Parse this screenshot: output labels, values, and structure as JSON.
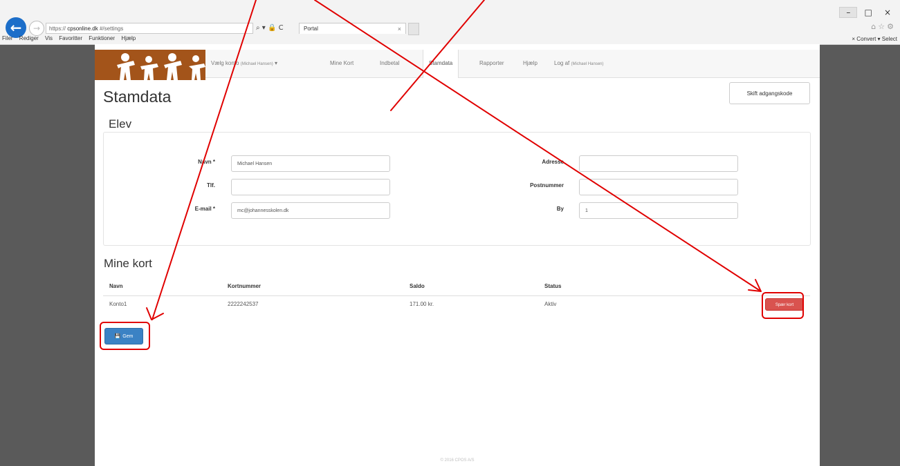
{
  "browser": {
    "address": "https://",
    "address_domain": "cpsonline.dk",
    "address_path": "#/settings",
    "search_hint": "⌕ ▾ 🔒 C",
    "tab_title": "Portal",
    "tab_close": "×",
    "menu": [
      "Filer",
      "Rediger",
      "Vis",
      "Favoritter",
      "Funktioner",
      "Hjælp"
    ],
    "right_tools": "×  Convert ▾  Select",
    "win_min": "–",
    "win_restore": "□",
    "win_close": "×",
    "back_glyph": "←",
    "forward_glyph": "→",
    "fav_icons": "⌂☆⚙"
  },
  "nav": {
    "items": [
      {
        "label": "Vælg konto",
        "sub": "(Michael Hansen)",
        "caret": "▾"
      },
      {
        "label": "Mine Kort"
      },
      {
        "label": "Indbetal"
      },
      {
        "label": "Stamdata",
        "active": true
      },
      {
        "label": "Rapporter"
      },
      {
        "label": "Hjælp"
      },
      {
        "label": "Log af",
        "sub": "(Michael Hansen)"
      }
    ]
  },
  "page": {
    "title": "Stamdata",
    "change_password": "Skift adgangskode"
  },
  "elev": {
    "heading": "Elev",
    "fields": {
      "navn": {
        "label": "Navn *",
        "value": "Michael Hansen"
      },
      "tlf": {
        "label": "Tlf.",
        "value": ""
      },
      "email": {
        "label": "E-mail *",
        "value": "mc@johannesskolen.dk"
      },
      "adresse": {
        "label": "Adresse",
        "value": ""
      },
      "postnummer": {
        "label": "Postnummer",
        "value": ""
      },
      "by": {
        "label": "By",
        "value": "1"
      }
    }
  },
  "cards": {
    "heading": "Mine kort",
    "columns": [
      "Navn",
      "Kortnummer",
      "Saldo",
      "Status"
    ],
    "rows": [
      {
        "navn": "Konto1",
        "kortnummer": "2222242537",
        "saldo": "171.00 kr.",
        "status": "Aktiv",
        "action": "Spær kort"
      }
    ]
  },
  "save_button": {
    "icon": "💾",
    "label": "Gem"
  },
  "footer": "© 2016 CPOS A/S",
  "annotation_color": "#e00000"
}
